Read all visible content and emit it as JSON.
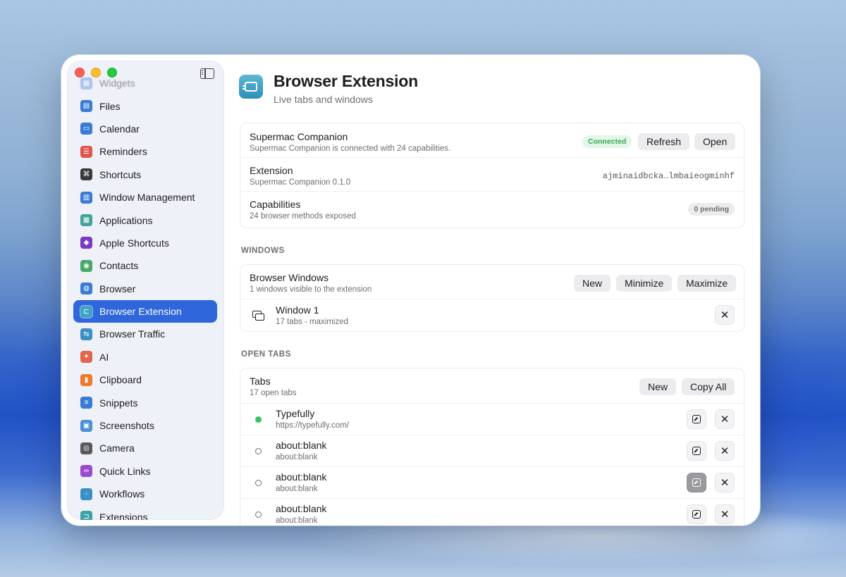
{
  "sidebar": {
    "items": [
      {
        "label": "Widgets",
        "icon": "widgets-icon",
        "color": "#5a8fe0"
      },
      {
        "label": "Files",
        "icon": "files-icon",
        "color": "#3a7bd5"
      },
      {
        "label": "Calendar",
        "icon": "calendar-icon",
        "color": "#3a7bd5"
      },
      {
        "label": "Reminders",
        "icon": "reminders-icon",
        "color": "#e0574a"
      },
      {
        "label": "Shortcuts",
        "icon": "command-icon",
        "color": "#3a3a3c"
      },
      {
        "label": "Window Management",
        "icon": "window-management-icon",
        "color": "#3a7bd5"
      },
      {
        "label": "Applications",
        "icon": "applications-icon",
        "color": "#3fa39a"
      },
      {
        "label": "Apple Shortcuts",
        "icon": "apple-shortcuts-icon",
        "color": "#7a3ac4"
      },
      {
        "label": "Contacts",
        "icon": "contacts-icon",
        "color": "#47a86a"
      },
      {
        "label": "Browser",
        "icon": "globe-icon",
        "color": "#3a7bd5"
      },
      {
        "label": "Browser Extension",
        "icon": "browser-extension-icon",
        "color": "#3fa3c4"
      },
      {
        "label": "Browser Traffic",
        "icon": "browser-traffic-icon",
        "color": "#3a8fc4"
      },
      {
        "label": "AI",
        "icon": "ai-icon",
        "color": "#e0674a"
      },
      {
        "label": "Clipboard",
        "icon": "clipboard-icon",
        "color": "#f07a2a"
      },
      {
        "label": "Snippets",
        "icon": "snippets-icon",
        "color": "#3a7bd5"
      },
      {
        "label": "Screenshots",
        "icon": "screenshots-icon",
        "color": "#4a8fd5"
      },
      {
        "label": "Camera",
        "icon": "camera-icon",
        "color": "#5a5a5e"
      },
      {
        "label": "Quick Links",
        "icon": "link-icon",
        "color": "#9a4ad0"
      },
      {
        "label": "Workflows",
        "icon": "workflows-icon",
        "color": "#3a8fc4"
      },
      {
        "label": "Extensions",
        "icon": "extensions-icon",
        "color": "#3fa3a4"
      }
    ],
    "active_index": 10
  },
  "header": {
    "title": "Browser Extension",
    "subtitle": "Live tabs and windows"
  },
  "status": {
    "companion_title": "Supermac Companion",
    "companion_sub": "Supermac Companion is connected with 24 capabilities.",
    "connected_badge": "Connected",
    "refresh_label": "Refresh",
    "open_label": "Open",
    "extension_title": "Extension",
    "extension_sub": "Supermac Companion 0.1.0",
    "extension_id": "ajminaidbcka…lmbaieogminhf",
    "capabilities_title": "Capabilities",
    "capabilities_sub": "24 browser methods exposed",
    "pending_badge": "0 pending"
  },
  "windows": {
    "section_label": "WINDOWS",
    "title": "Browser Windows",
    "sub": "1 windows visible to the extension",
    "new_label": "New",
    "minimize_label": "Minimize",
    "maximize_label": "Maximize",
    "items": [
      {
        "title": "Window 1",
        "sub": "17 tabs - maximized"
      }
    ]
  },
  "tabs": {
    "section_label": "OPEN TABS",
    "title": "Tabs",
    "sub": "17 open tabs",
    "new_label": "New",
    "copy_all_label": "Copy All",
    "items": [
      {
        "title": "Typefully",
        "url": "https://typefully.com/",
        "active": true
      },
      {
        "title": "about:blank",
        "url": "about:blank",
        "active": false
      },
      {
        "title": "about:blank",
        "url": "about:blank",
        "active": false
      },
      {
        "title": "about:blank",
        "url": "about:blank",
        "active": false
      }
    ]
  },
  "colors": {
    "accent": "#2f66db",
    "connected_green": "#34a853"
  }
}
